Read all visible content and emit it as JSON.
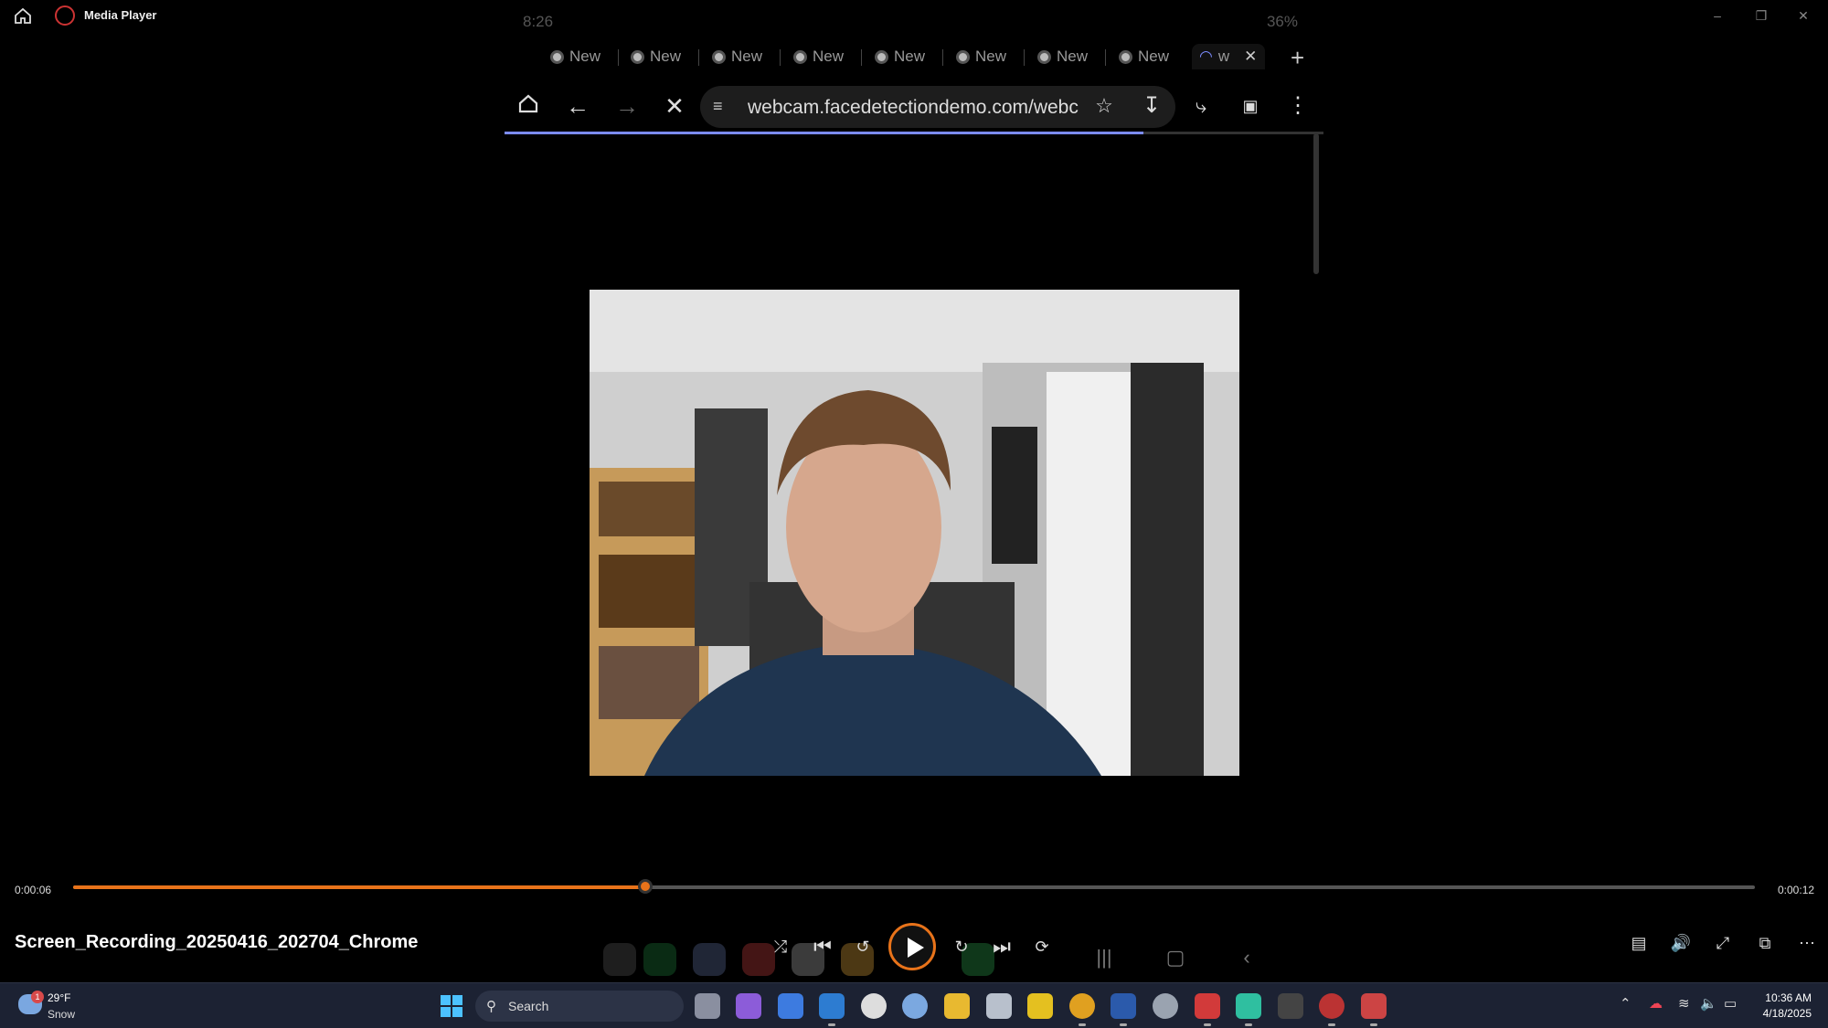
{
  "titlebar": {
    "app_title": "Media Player",
    "controls": {
      "minimize": "–",
      "restore": "❐",
      "close": "✕"
    }
  },
  "phone": {
    "status_time": "8:26",
    "status_battery": "36%",
    "tabs": [
      "New",
      "New",
      "New",
      "New",
      "New",
      "New",
      "New",
      "New"
    ],
    "active_tab": "w",
    "new_tab": "+",
    "url": "webcam.facedetectiondemo.com/webc",
    "page_load_progress": 0.78
  },
  "player": {
    "current_time": "0:00:06",
    "total_time": "0:00:12",
    "progress": 0.34,
    "media_title": "Screen_Recording_20250416_202704_Chrome",
    "accent_color": "#e8731a"
  },
  "taskbar": {
    "weather_temp": "29°F",
    "weather_cond": "Snow",
    "weather_badge": "1",
    "search_placeholder": "Search",
    "clock_time": "10:36 AM",
    "clock_date": "4/18/2025"
  }
}
